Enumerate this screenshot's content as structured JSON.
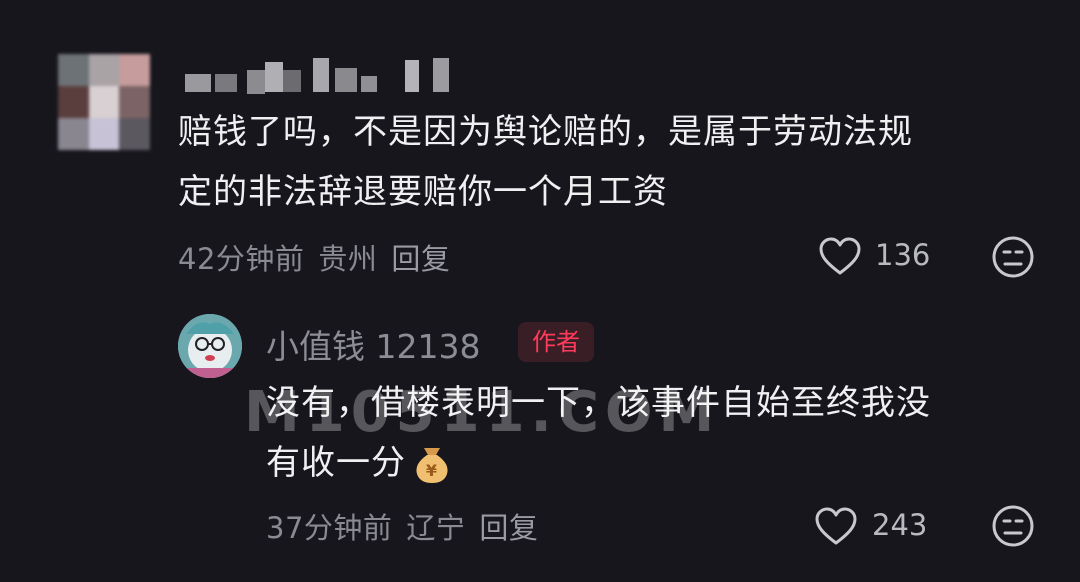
{
  "comment": {
    "text_line1": "赔钱了吗，不是因为舆论赔的，是属于劳动法规",
    "text_line2": "定的非法辞退要赔你一个月工资",
    "time": "42分钟前",
    "location": "贵州",
    "reply_label": "回复",
    "likes": "136",
    "like_icon": "heart-outline-icon",
    "dislike_icon": "neutral-face-icon"
  },
  "reply": {
    "username": "小值钱 12138",
    "badge": "作者",
    "text_line1": "没有，借楼表明一下，该事件自始至终我没",
    "text_line2": "有收一分",
    "emoji_icon": "money-bag-icon",
    "time": "37分钟前",
    "location": "辽宁",
    "reply_label": "回复",
    "likes": "243"
  },
  "watermark": "M10511.COM",
  "colors": {
    "background": "#16161c",
    "badge_text": "#ff3b5c",
    "badge_bg": "#3a1e26"
  }
}
